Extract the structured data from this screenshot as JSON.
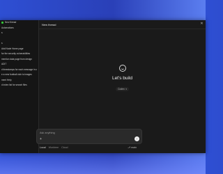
{
  "window": {
    "title": "New thread"
  },
  "sidebar": {
    "items": [
      {
        "label": "New thread"
      },
      {
        "label": "Automations"
      },
      {
        "label": "s"
      },
      {
        "label": ""
      },
      {
        "label": "s"
      },
      {
        "label": "Add Node Home page"
      },
      {
        "label": "for the security vulnerabilities"
      },
      {
        "label": "mention data page from design"
      },
      {
        "label": "ADIT"
      },
      {
        "label": "d timestamps for each message in c"
      },
      {
        "label": "e a new football club to images"
      },
      {
        "label": "ment Help"
      },
      {
        "label": "d index list for search files"
      }
    ]
  },
  "main": {
    "heading": "Let's build",
    "env_pill": "Codex",
    "composer": {
      "placeholder": "Ask anything",
      "plus": "+",
      "send": "↑"
    },
    "modes": [
      "Local",
      "Worktree",
      "Cloud"
    ],
    "branch": "main"
  },
  "colors": {
    "accent": "#37c83a",
    "window_bg": "#1a1a1a",
    "sidebar_bg": "#151515",
    "desktop_blue": "#2e4fd3"
  },
  "icons": {
    "logo": "chat-bubble-smile-icon",
    "close": "close-icon",
    "send": "arrow-up-icon",
    "plus": "plus-icon",
    "branch": "git-branch-icon"
  }
}
